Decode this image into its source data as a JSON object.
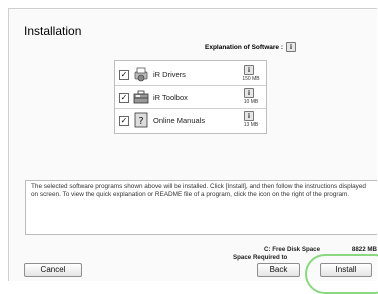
{
  "title": "Installation",
  "explanation_label": "Explanation of Software :",
  "software": [
    {
      "name": "iR Drivers",
      "size": "150 MB",
      "checked": true,
      "icon": "printer-driver-icon"
    },
    {
      "name": "iR Toolbox",
      "size": "10 MB",
      "checked": true,
      "icon": "toolbox-icon"
    },
    {
      "name": "Online Manuals",
      "size": "13 MB",
      "checked": true,
      "icon": "manual-book-icon"
    }
  ],
  "description": "The selected software programs shown above will be installed. Click [Install], and then follow the instructions displayed on screen. To view the quick explanation or README file of a program, click the icon on the right of the program.",
  "disk": {
    "free_label": "C: Free Disk Space",
    "free_value": "8822 MB",
    "required_label": "Space Required to"
  },
  "buttons": {
    "cancel": "Cancel",
    "back": "Back",
    "install": "Install"
  },
  "colors": {
    "highlight": "#8ad87f"
  }
}
